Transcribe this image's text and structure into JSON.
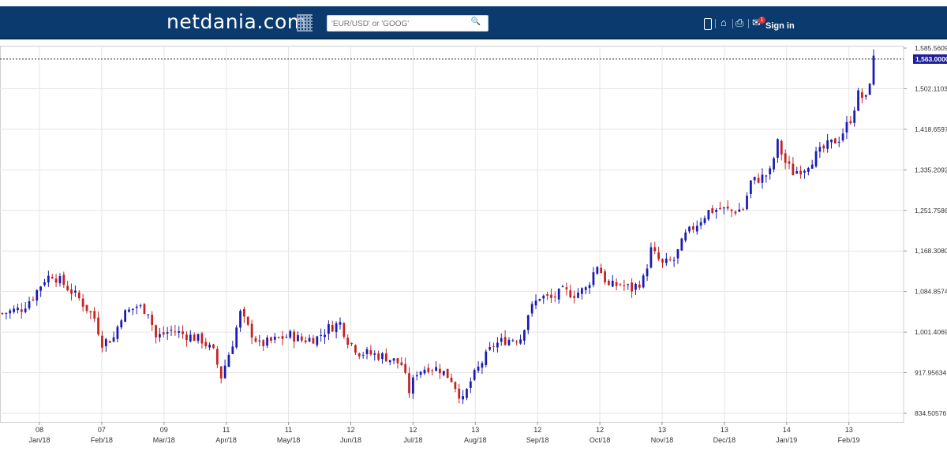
{
  "header": {
    "logo": "netdania.com",
    "search_placeholder": "'EUR/USD' or 'GOOG'",
    "signin_label": "Sign in",
    "mail_badge": "1"
  },
  "colors": {
    "header_bg": "#0a3a6e",
    "up": "#1a1ab4",
    "down": "#c62020",
    "grid": "#e4e4e4",
    "price_tag_bg": "#1f1f9a"
  },
  "chart_data": {
    "type": "candlestick",
    "current_price": "1,563.0000",
    "current_value": 1563.0,
    "y_ticks": [
      {
        "label": "1,585.5609",
        "value": 1585.5609
      },
      {
        "label": "1,502.1103",
        "value": 1502.1103
      },
      {
        "label": "1,418.6597",
        "value": 1418.6597
      },
      {
        "label": "1,335.2092",
        "value": 1335.2092
      },
      {
        "label": "1,251.7586",
        "value": 1251.7586
      },
      {
        "label": "1,168.3080",
        "value": 1168.308
      },
      {
        "label": "1,084.8574",
        "value": 1084.8574
      },
      {
        "label": "1,001.4069",
        "value": 1001.4069
      },
      {
        "label": "917.95634",
        "value": 917.95634
      },
      {
        "label": "834.50576",
        "value": 834.50576
      }
    ],
    "ylim": [
      800,
      1600
    ],
    "x_ticks": [
      {
        "day": "08",
        "month": "Jan/18"
      },
      {
        "day": "07",
        "month": "Feb/18"
      },
      {
        "day": "09",
        "month": "Mar/18"
      },
      {
        "day": "11",
        "month": "Apr/18"
      },
      {
        "day": "11",
        "month": "May/18"
      },
      {
        "day": "12",
        "month": "Jun/18"
      },
      {
        "day": "12",
        "month": "Jul/18"
      },
      {
        "day": "13",
        "month": "Aug/18"
      },
      {
        "day": "12",
        "month": "Sep/18"
      },
      {
        "day": "12",
        "month": "Oct/18"
      },
      {
        "day": "13",
        "month": "Nov/18"
      },
      {
        "day": "13",
        "month": "Dec/18"
      },
      {
        "day": "14",
        "month": "Jan/19"
      },
      {
        "day": "13",
        "month": "Feb/19"
      }
    ],
    "close_path": [
      [
        0,
        1040
      ],
      [
        5,
        1050
      ],
      [
        8,
        1075
      ],
      [
        11,
        1110
      ],
      [
        13,
        1120
      ],
      [
        16,
        1100
      ],
      [
        20,
        1070
      ],
      [
        24,
        1030
      ],
      [
        26,
        980
      ],
      [
        29,
        990
      ],
      [
        31,
        1035
      ],
      [
        35,
        1055
      ],
      [
        38,
        1045
      ],
      [
        40,
        990
      ],
      [
        44,
        1005
      ],
      [
        48,
        995
      ],
      [
        52,
        985
      ],
      [
        55,
        960
      ],
      [
        57,
        910
      ],
      [
        60,
        980
      ],
      [
        62,
        1040
      ],
      [
        64,
        1010
      ],
      [
        67,
        975
      ],
      [
        71,
        985
      ],
      [
        75,
        995
      ],
      [
        78,
        985
      ],
      [
        82,
        990
      ],
      [
        85,
        1010
      ],
      [
        88,
        1020
      ],
      [
        90,
        985
      ],
      [
        93,
        960
      ],
      [
        97,
        955
      ],
      [
        100,
        950
      ],
      [
        104,
        935
      ],
      [
        106,
        880
      ],
      [
        108,
        920
      ],
      [
        111,
        930
      ],
      [
        114,
        925
      ],
      [
        117,
        905
      ],
      [
        120,
        860
      ],
      [
        122,
        900
      ],
      [
        125,
        940
      ],
      [
        128,
        975
      ],
      [
        131,
        985
      ],
      [
        135,
        990
      ],
      [
        137,
        1040
      ],
      [
        140,
        1075
      ],
      [
        143,
        1070
      ],
      [
        146,
        1085
      ],
      [
        149,
        1080
      ],
      [
        152,
        1090
      ],
      [
        155,
        1140
      ],
      [
        158,
        1095
      ],
      [
        161,
        1100
      ],
      [
        164,
        1090
      ],
      [
        167,
        1110
      ],
      [
        169,
        1170
      ],
      [
        172,
        1140
      ],
      [
        175,
        1150
      ],
      [
        178,
        1200
      ],
      [
        181,
        1225
      ],
      [
        184,
        1250
      ],
      [
        187,
        1255
      ],
      [
        190,
        1250
      ],
      [
        193,
        1255
      ],
      [
        195,
        1310
      ],
      [
        198,
        1320
      ],
      [
        200,
        1330
      ],
      [
        202,
        1390
      ],
      [
        204,
        1350
      ],
      [
        206,
        1330
      ],
      [
        209,
        1340
      ],
      [
        212,
        1365
      ],
      [
        215,
        1385
      ],
      [
        218,
        1400
      ],
      [
        221,
        1440
      ],
      [
        223,
        1490
      ],
      [
        225,
        1480
      ],
      [
        226,
        1520
      ],
      [
        227,
        1563
      ]
    ],
    "n_bars": 228
  }
}
